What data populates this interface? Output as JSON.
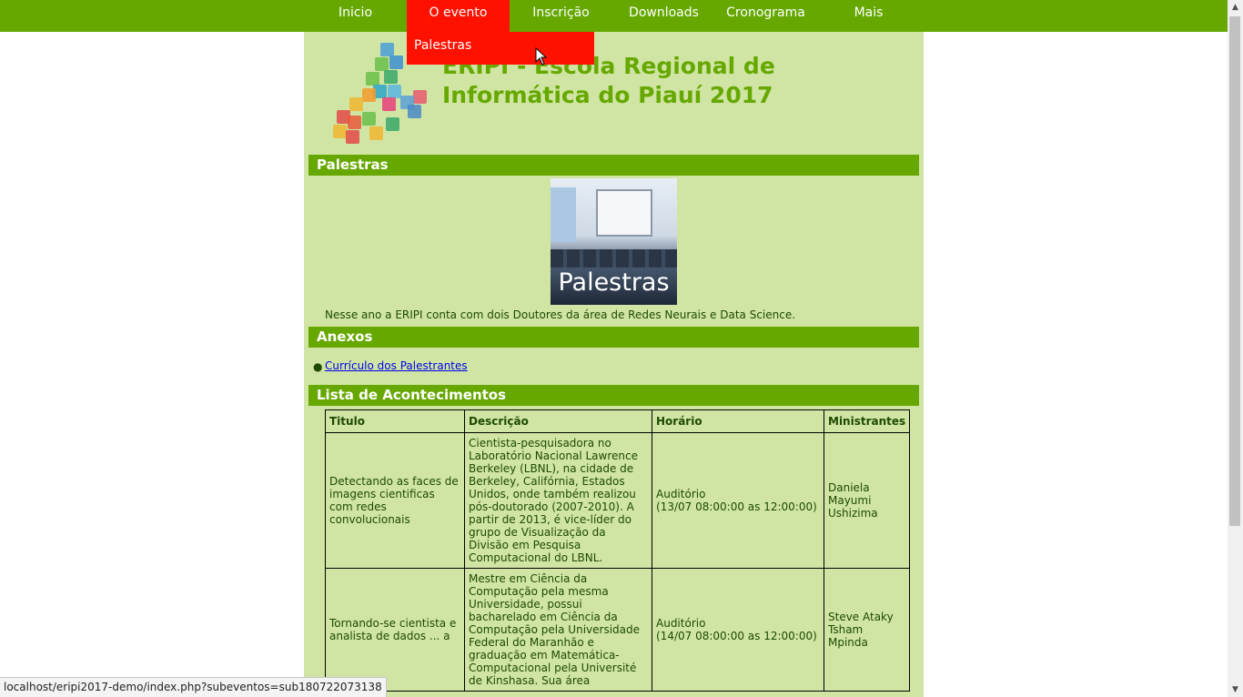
{
  "nav": {
    "items": [
      {
        "label": "Inicio"
      },
      {
        "label": "O evento"
      },
      {
        "label": "Inscrição"
      },
      {
        "label": "Downloads"
      },
      {
        "label": "Cronograma"
      },
      {
        "label": "Mais"
      }
    ],
    "active_index": 1,
    "dropdown_item": "Palestras"
  },
  "header": {
    "title": "ERIPI - Escola Regional de Informática do Piauí 2017"
  },
  "sections": {
    "palestras_title": "Palestras",
    "hero_label": "Palestras",
    "intro": "Nesse ano a ERIPI conta com dois Doutores da área de Redes Neurais e Data Science.",
    "anexos_title": "Anexos",
    "attachment_link": "Currículo dos Palestrantes",
    "lista_title": "Lista de Acontecimentos"
  },
  "table": {
    "headers": [
      "Titulo",
      "Descrição",
      "Horário",
      "Ministrantes"
    ],
    "rows": [
      {
        "titulo": "Detectando as faces de imagens cientificas com redes convolucionais",
        "descricao": "Cientista-pesquisadora no Laboratório Nacional Lawrence Berkeley (LBNL), na cidade de Berkeley, Califórnia, Estados Unidos, onde também realizou pós-doutorado (2007-2010). A partir de 2013, é vice-líder do grupo de Visualização da Divisão em Pesquisa Computacional do LBNL.",
        "local": "Auditório",
        "horario": "(13/07 08:00:00 as 12:00:00)",
        "ministrantes": "Daniela Mayumi Ushizima"
      },
      {
        "titulo": "Tornando-se cientista e analista de dados ... a",
        "descricao": "Mestre em Ciência da Computação pela mesma Universidade, possui bacharelado em Ciência da Computação pela Universidade Federal do Maranhão e graduação em Matemática-Computacional pela Université de Kinshasa. Sua área",
        "local": "Auditório",
        "horario": "(14/07 08:00:00 as 12:00:00)",
        "ministrantes": "Steve Ataky Tsham Mpinda"
      }
    ]
  },
  "status": {
    "url": "localhost/eripi2017-demo/index.php?subeventos=sub180722073138"
  },
  "colors": {
    "nav_green": "#66a800",
    "active_red": "#ff1100",
    "page_bg": "#d0e5a4"
  }
}
